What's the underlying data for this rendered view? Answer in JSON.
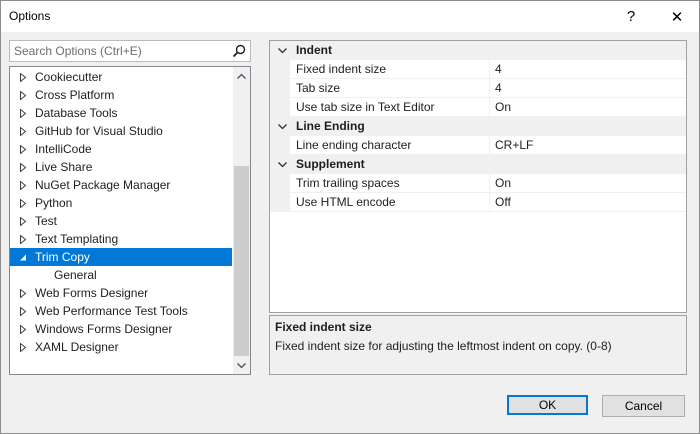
{
  "window": {
    "title": "Options"
  },
  "titlebar": {
    "help_glyph": "?",
    "close_glyph": "✕"
  },
  "search": {
    "placeholder": "Search Options (Ctrl+E)"
  },
  "tree": {
    "items": [
      {
        "label": "Cookiecutter",
        "expander": "collapsed"
      },
      {
        "label": "Cross Platform",
        "expander": "collapsed"
      },
      {
        "label": "Database Tools",
        "expander": "collapsed"
      },
      {
        "label": "GitHub for Visual Studio",
        "expander": "collapsed"
      },
      {
        "label": "IntelliCode",
        "expander": "collapsed"
      },
      {
        "label": "Live Share",
        "expander": "collapsed"
      },
      {
        "label": "NuGet Package Manager",
        "expander": "collapsed"
      },
      {
        "label": "Python",
        "expander": "collapsed"
      },
      {
        "label": "Test",
        "expander": "collapsed"
      },
      {
        "label": "Text Templating",
        "expander": "collapsed"
      },
      {
        "label": "Trim Copy",
        "expander": "expanded",
        "selected": true
      },
      {
        "label": "General",
        "expander": "none",
        "child": true
      },
      {
        "label": "Web Forms Designer",
        "expander": "collapsed"
      },
      {
        "label": "Web Performance Test Tools",
        "expander": "collapsed"
      },
      {
        "label": "Windows Forms Designer",
        "expander": "collapsed"
      },
      {
        "label": "XAML Designer",
        "expander": "collapsed"
      }
    ]
  },
  "grid": {
    "categories": [
      {
        "name": "Indent",
        "properties": [
          {
            "name": "Fixed indent size",
            "value": "4"
          },
          {
            "name": "Tab size",
            "value": "4"
          },
          {
            "name": "Use tab size in Text Editor",
            "value": "On"
          }
        ]
      },
      {
        "name": "Line Ending",
        "properties": [
          {
            "name": "Line ending character",
            "value": "CR+LF"
          }
        ]
      },
      {
        "name": "Supplement",
        "properties": [
          {
            "name": "Trim trailing spaces",
            "value": "On"
          },
          {
            "name": "Use HTML encode",
            "value": "Off"
          }
        ]
      }
    ]
  },
  "description": {
    "title": "Fixed indent size",
    "text": "Fixed indent size for adjusting the leftmost indent on copy. (0-8)"
  },
  "buttons": {
    "ok": "OK",
    "cancel": "Cancel"
  },
  "colors": {
    "selection": "#0078d7",
    "panel": "#f0f0f0"
  }
}
